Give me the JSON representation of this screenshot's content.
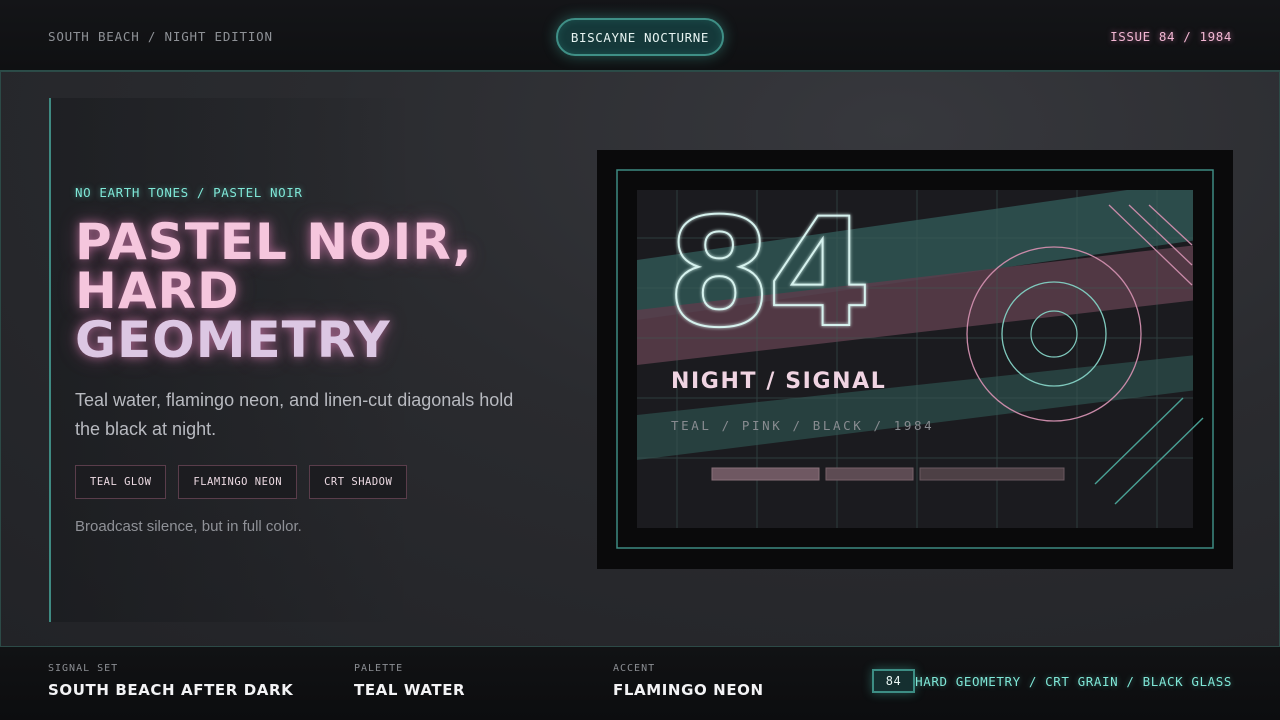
{
  "header": {
    "section": "SOUTH BEACH / NIGHT EDITION",
    "brand": "BISCAYNE NOCTURNE",
    "issue": "ISSUE 84 / 1984"
  },
  "hero": {
    "eyebrow": "NO EARTH TONES / PASTEL NOIR",
    "headline_lines": [
      "PASTEL NOIR,",
      "HARD",
      "GEOMETRY"
    ],
    "subcopy": "Teal water, flamingo neon, and linen-cut diagonals hold the black at night.",
    "chips": [
      "TEAL GLOW",
      "FLAMINGO NEON",
      "CRT SHADOW"
    ],
    "tagline": "Broadcast silence, but in full color."
  },
  "card": {
    "numeral": "84",
    "title": "NIGHT / SIGNAL",
    "subtitle": "TEAL / PINK / BLACK / 1984"
  },
  "footer": {
    "signal_set_label": "SIGNAL SET",
    "signal_set_value": "SOUTH BEACH AFTER DARK",
    "palette_label": "PALETTE",
    "palette_value": "TEAL WATER",
    "accent_label": "ACCENT",
    "accent_value": "FLAMINGO NEON",
    "badge": "84",
    "tags": "HARD GEOMETRY / CRT GRAIN / BLACK GLASS"
  },
  "colors": {
    "teal": "#7fe7d7",
    "pink": "#f5c6dd",
    "black": "#0a0a0b"
  }
}
